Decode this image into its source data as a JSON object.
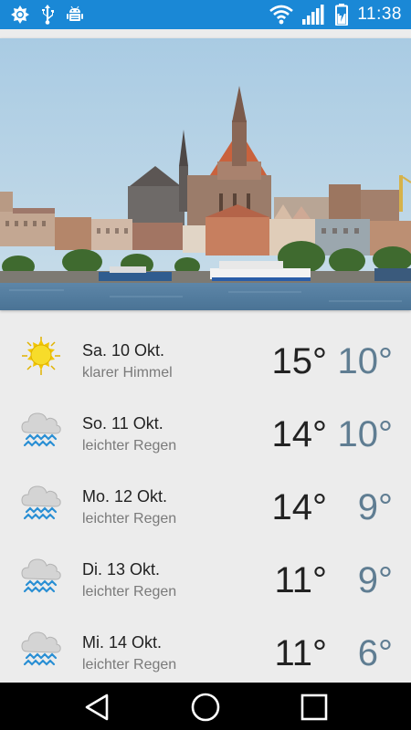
{
  "status_bar": {
    "time": "11:38",
    "left_icons": [
      "brightness-icon",
      "usb-icon",
      "android-debug-icon"
    ],
    "right_icons": [
      "wifi-icon",
      "signal-icon",
      "battery-charging-icon"
    ]
  },
  "header_photo": {
    "icon": "city-skyline-photo"
  },
  "forecast": [
    {
      "day": "Sa. 10 Okt.",
      "condition": "klarer Himmel",
      "high": "15°",
      "low": "10°",
      "icon": "sun-icon"
    },
    {
      "day": "So. 11 Okt.",
      "condition": "leichter Regen",
      "high": "14°",
      "low": "10°",
      "icon": "rain-cloud-icon"
    },
    {
      "day": "Mo. 12 Okt.",
      "condition": "leichter Regen",
      "high": "14°",
      "low": "9°",
      "icon": "rain-cloud-icon"
    },
    {
      "day": "Di. 13 Okt.",
      "condition": "leichter Regen",
      "high": "11°",
      "low": "9°",
      "icon": "rain-cloud-icon"
    },
    {
      "day": "Mi. 14 Okt.",
      "condition": "leichter Regen",
      "high": "11°",
      "low": "6°",
      "icon": "rain-cloud-icon"
    }
  ],
  "nav_bar": {
    "icons": [
      "back-icon",
      "home-icon",
      "recents-icon"
    ]
  },
  "colors": {
    "status_bar": "#1a88d6",
    "background": "#ececec",
    "low_temp": "#5f7d92",
    "rain_drops": "#2a8fd4"
  }
}
